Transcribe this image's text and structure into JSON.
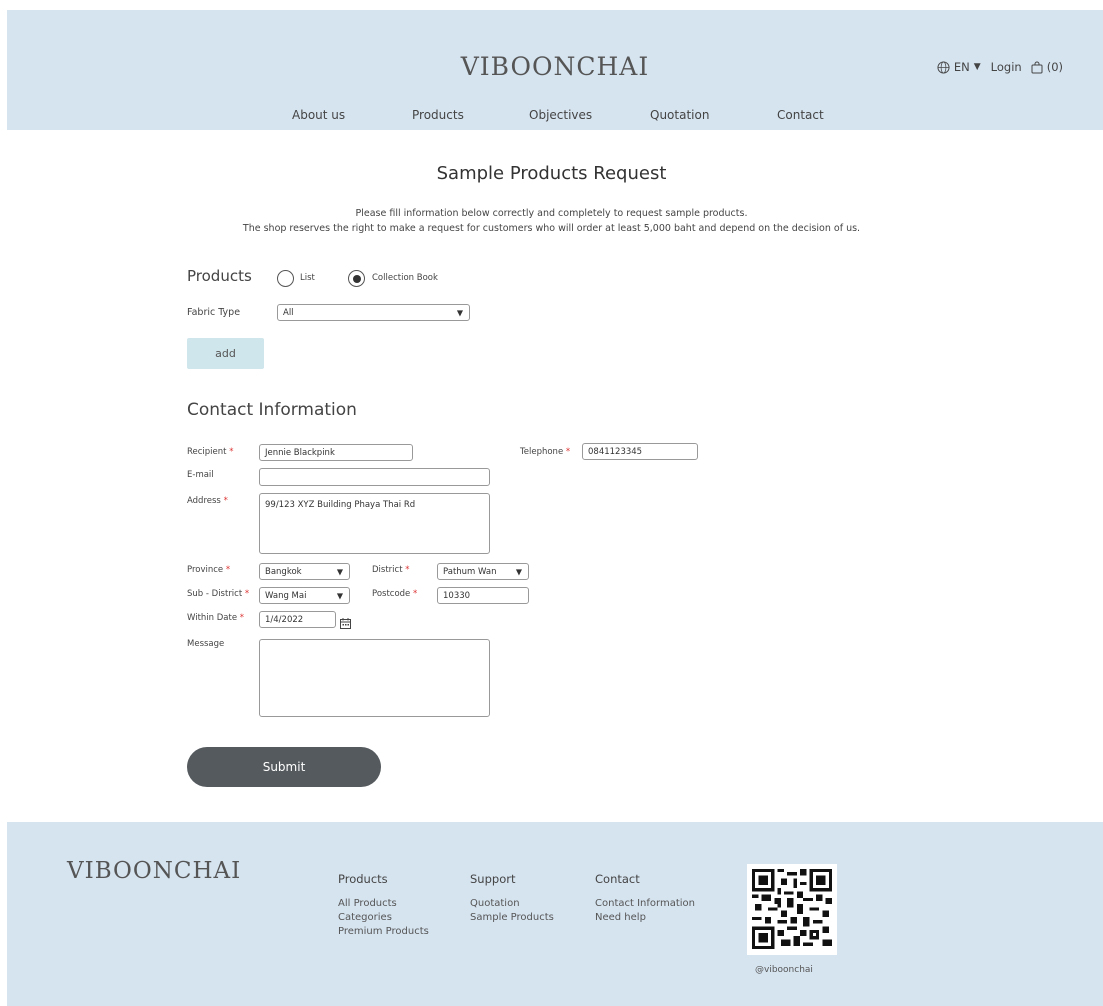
{
  "header": {
    "brand": "VIBOONCHAI",
    "language": "EN",
    "login": "Login",
    "cart": "(0)",
    "nav": [
      "About us",
      "Products",
      "Objectives",
      "Quotation",
      "Contact"
    ]
  },
  "page": {
    "title": "Sample Products Request",
    "intro_line1": "Please fill information below correctly and completely to request sample products.",
    "intro_line2": "The shop reserves the right to make a request for customers who will order at least 5,000 baht and depend on the decision of us."
  },
  "products": {
    "heading": "Products",
    "option_list": "List",
    "option_collection": "Collection Book",
    "selected": "Collection Book",
    "fabric_type_label": "Fabric Type",
    "fabric_type_value": "All",
    "add_label": "add"
  },
  "contact": {
    "heading": "Contact Information",
    "recipient_label": "Recipient",
    "recipient_value": "Jennie Blackpink",
    "telephone_label": "Telephone",
    "telephone_value": "0841123345",
    "email_label": "E-mail",
    "email_value": "",
    "address_label": "Address",
    "address_value": "99/123 XYZ Building Phaya Thai Rd",
    "province_label": "Province",
    "province_value": "Bangkok",
    "district_label": "District",
    "district_value": "Pathum Wan",
    "subdistrict_label": "Sub - District",
    "subdistrict_value": "Wang Mai",
    "postcode_label": "Postcode",
    "postcode_value": "10330",
    "within_date_label": "Within Date",
    "within_date_value": "1/4/2022",
    "message_label": "Message",
    "message_value": "",
    "required_mark": "*",
    "submit_label": "Submit"
  },
  "footer": {
    "brand": "VIBOONCHAI",
    "columns": [
      {
        "heading": "Products",
        "items": [
          "All Products",
          "Categories",
          "Premium Products"
        ]
      },
      {
        "heading": "Support",
        "items": [
          "Quotation",
          "Sample Products"
        ]
      },
      {
        "heading": "Contact",
        "items": [
          "Contact Information",
          "Need help"
        ]
      }
    ],
    "qr_handle": "@viboonchai"
  },
  "colors": {
    "header_bg": "#d6e4f0",
    "add_button_bg": "#cfe6ec",
    "submit_button_bg": "#555a5e",
    "required": "#dd3333"
  },
  "icons": [
    "globe-icon",
    "caret-down-icon",
    "shopping-bag-icon",
    "calendar-icon",
    "qr-code-image"
  ]
}
